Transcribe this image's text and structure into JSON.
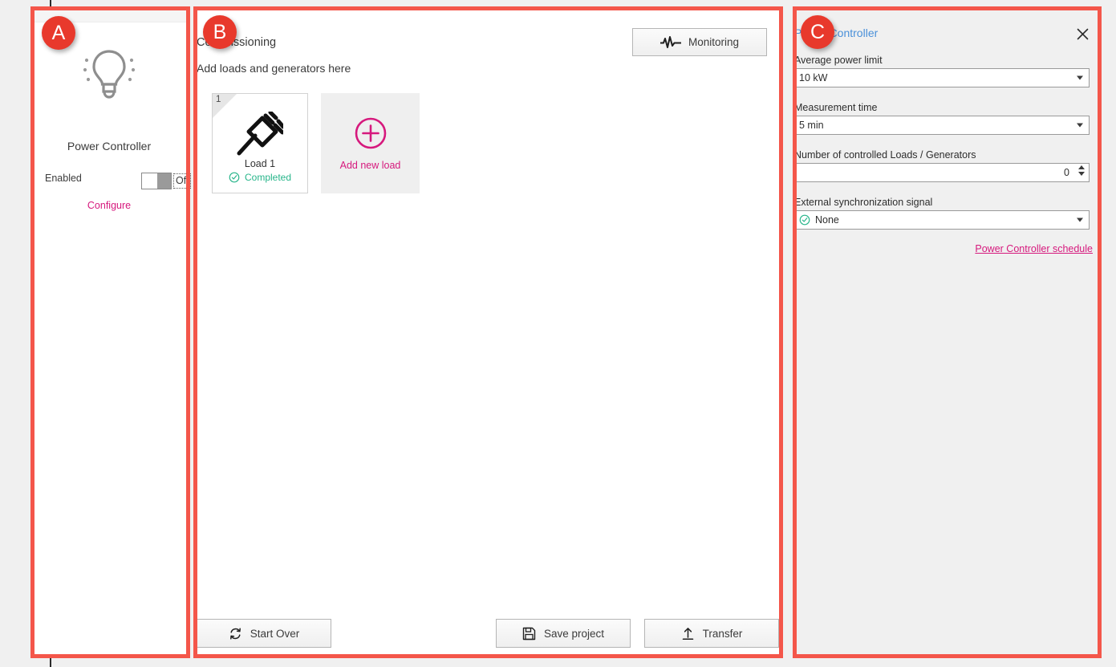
{
  "panel_a": {
    "icon": "lightbulb-icon",
    "title": "Power Controller",
    "enabled_label": "Enabled",
    "toggle_state": "Off",
    "configure_link": "Configure"
  },
  "panel_b": {
    "heading": "Commissioning",
    "subheading": "Add loads and generators here",
    "monitoring_button": "Monitoring",
    "monitoring_icon": "waveform-icon",
    "cards": [
      {
        "number": "1",
        "icon": "plug-icon",
        "label": "Load 1",
        "status": "Completed",
        "status_icon": "check-circle-icon",
        "status_color": "#27b58a"
      }
    ],
    "add_card": {
      "icon": "plus-circle-icon",
      "label": "Add new load"
    },
    "footer": {
      "start_over": "Start Over",
      "start_over_icon": "refresh-icon",
      "save_project": "Save project",
      "save_project_icon": "floppy-disk-icon",
      "transfer": "Transfer",
      "transfer_icon": "upload-arrow-icon"
    }
  },
  "panel_c": {
    "title": "Power Controller",
    "close_icon": "close-icon",
    "fields": [
      {
        "label": "Average power limit",
        "value": "10 kW",
        "type": "select"
      },
      {
        "label": "Measurement time",
        "value": "5 min",
        "type": "select"
      },
      {
        "label": "Number of controlled Loads / Generators",
        "value": "0",
        "type": "spinner"
      },
      {
        "label": "External synchronization signal",
        "value": "None",
        "type": "select",
        "icon": "check-circle-icon"
      }
    ],
    "schedule_link": "Power Controller schedule"
  },
  "annotations": {
    "badges": [
      {
        "letter": "A"
      },
      {
        "letter": "B"
      },
      {
        "letter": "C"
      }
    ]
  },
  "colors": {
    "accent_pink": "#d6197d",
    "annotation_red": "#e8392c",
    "status_green": "#27b58a",
    "title_blue": "#4a90d9"
  }
}
